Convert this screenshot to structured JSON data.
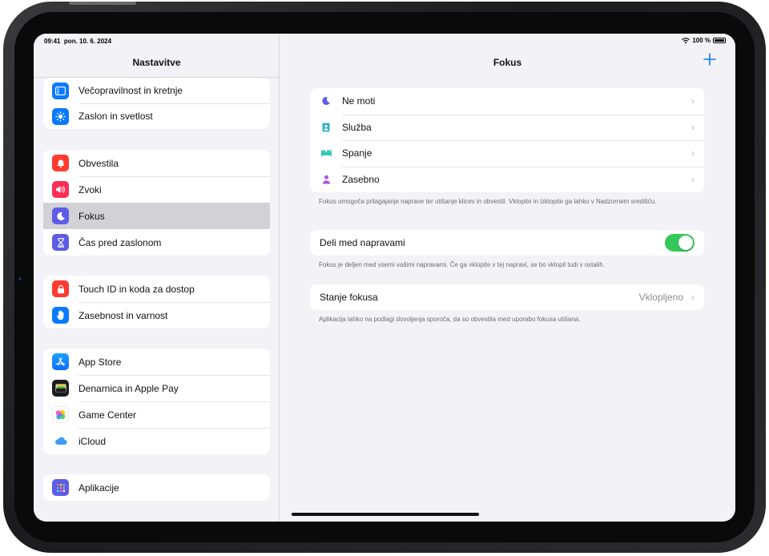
{
  "status": {
    "time": "09:41",
    "date": "pon. 10. 6. 2024",
    "battery": "100 %"
  },
  "sidebar": {
    "title": "Nastavitve",
    "groups": [
      [
        {
          "label": "Večopravilnost in kretnje",
          "icon": "multitasking-icon",
          "color": "#0a7aff"
        },
        {
          "label": "Zaslon in svetlost",
          "icon": "brightness-icon",
          "color": "#0a7aff"
        }
      ],
      [
        {
          "label": "Obvestila",
          "icon": "notifications-icon",
          "color": "#ff3b30"
        },
        {
          "label": "Zvoki",
          "icon": "sounds-icon",
          "color": "#ff2d55"
        },
        {
          "label": "Fokus",
          "icon": "moon-icon",
          "color": "#5e5ce6",
          "selected": true
        },
        {
          "label": "Čas pred zaslonom",
          "icon": "hourglass-icon",
          "color": "#5e5ce6"
        }
      ],
      [
        {
          "label": "Touch ID in koda za dostop",
          "icon": "lock-icon",
          "color": "#ff3b30"
        },
        {
          "label": "Zasebnost in varnost",
          "icon": "hand-icon",
          "color": "#0a7aff"
        }
      ],
      [
        {
          "label": "App Store",
          "icon": "app-store-icon",
          "color": "#0a84ff"
        },
        {
          "label": "Denarnica in Apple Pay",
          "icon": "wallet-icon",
          "color": "#1c1c1e"
        },
        {
          "label": "Game Center",
          "icon": "game-center-icon",
          "color": "#ffffff"
        },
        {
          "label": "iCloud",
          "icon": "icloud-icon",
          "color": "#ffffff"
        }
      ],
      [
        {
          "label": "Aplikacije",
          "icon": "apps-grid-icon",
          "color": "#5e5ce6"
        }
      ]
    ]
  },
  "detail": {
    "title": "Fokus",
    "focus_modes": [
      {
        "label": "Ne moti",
        "icon": "moon-icon",
        "color": "#5e5ce6"
      },
      {
        "label": "Služba",
        "icon": "badge-icon",
        "color": "#30b0c7"
      },
      {
        "label": "Spanje",
        "icon": "bed-icon",
        "color": "#30c7b5"
      },
      {
        "label": "Zasebno",
        "icon": "person-icon",
        "color": "#af52de"
      }
    ],
    "focus_footer": "Fokus omogoča prilagajanje naprave ter utišanje klicev in obvestil. Vklopite in izklopite ga lahko v Nadzornem središču.",
    "share_label": "Deli med napravami",
    "share_enabled": true,
    "share_footer": "Fokus je deljen med vsemi vašimi napravami. Če ga vklopite v tej napravi, se bo vklopil tudi v ostalih.",
    "status_label": "Stanje fokusa",
    "status_value": "Vklopljeno",
    "status_footer": "Aplikacija lahko na podlagi dovoljenja sporoča, da so obvestila med uporabo fokusa utišana."
  }
}
